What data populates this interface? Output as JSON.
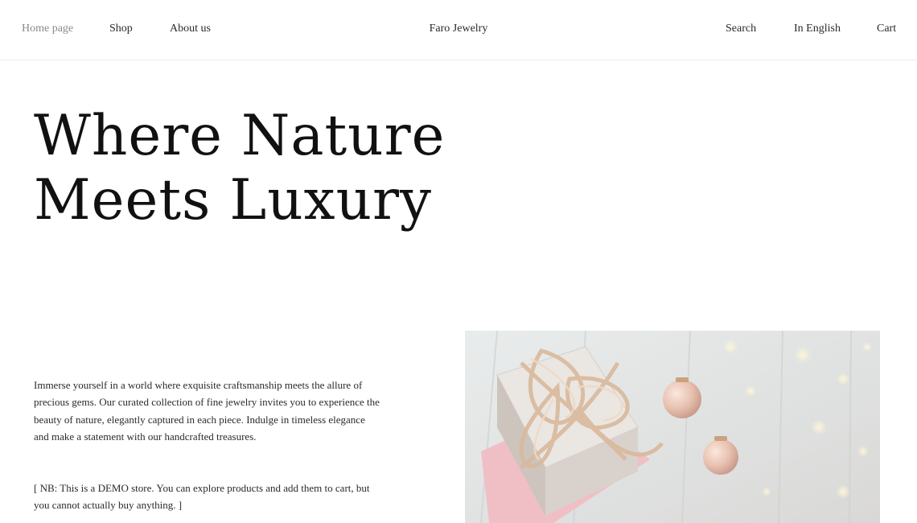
{
  "nav": {
    "home": "Home page",
    "shop": "Shop",
    "about": "About us",
    "brand": "Faro Jewelry",
    "search": "Search",
    "language": "In English",
    "cart": "Cart"
  },
  "hero": {
    "title_line1": "Where Nature",
    "title_line2": "Meets Luxury",
    "intro": "Immerse yourself in a world where exquisite craftsmanship meets the allure of precious gems. Our curated collection of fine jewelry invites you to experience the beauty of nature, elegantly captured in each piece. Indulge in timeless elegance and make a statement with our handcrafted treasures.",
    "note": "[ NB: This is a DEMO store. You can explore products and add them to cart, but you cannot actually buy anything. ]",
    "image_subject": "gift-box-with-ribbon-photo"
  },
  "colors": {
    "text": "#1a1a1a",
    "muted_nav": "#8a8a8a",
    "divider": "#ececec",
    "background": "#ffffff"
  }
}
